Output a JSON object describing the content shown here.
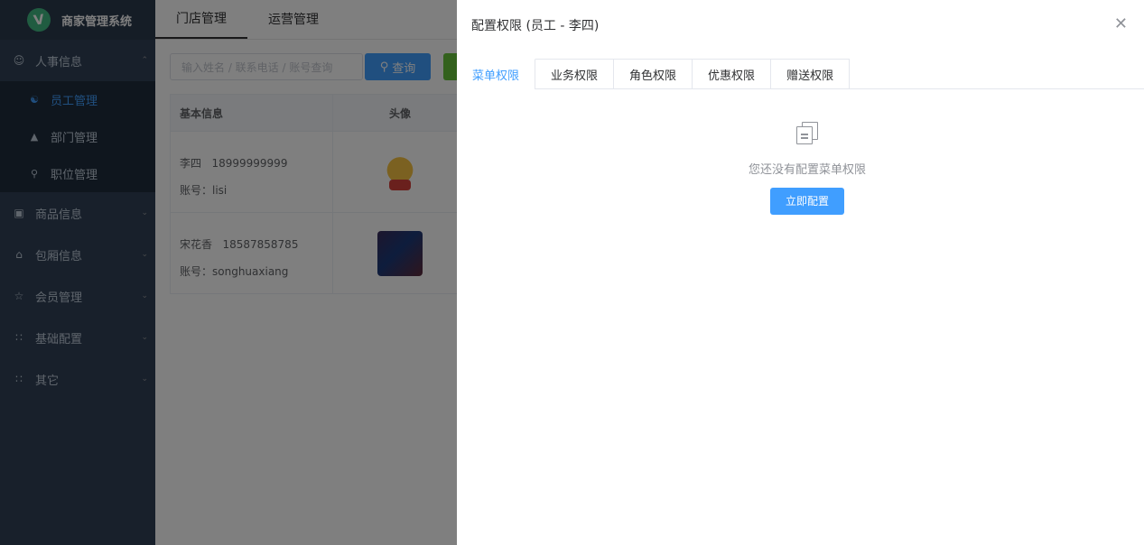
{
  "sidebar": {
    "logo_letter": "V",
    "title": "商家管理系统",
    "menu": [
      {
        "label": "人事信息",
        "icon": "user-icon"
      },
      {
        "label": "商品信息",
        "icon": "goods-icon"
      },
      {
        "label": "包厢信息",
        "icon": "room-icon"
      },
      {
        "label": "会员管理",
        "icon": "member-icon"
      },
      {
        "label": "基础配置",
        "icon": "grid-icon"
      },
      {
        "label": "其它",
        "icon": "grid-icon"
      }
    ],
    "submenu": [
      {
        "label": "员工管理",
        "icon": "staff-icon",
        "active": true
      },
      {
        "label": "部门管理",
        "icon": "org-icon"
      },
      {
        "label": "职位管理",
        "icon": "position-icon"
      }
    ]
  },
  "main": {
    "tabs": [
      "门店管理",
      "运营管理"
    ],
    "search": {
      "placeholder": "输入姓名 / 联系电话 / 账号查询",
      "button": "查询"
    },
    "table": {
      "headers": [
        "基本信息",
        "头像"
      ],
      "rows": [
        {
          "name": "李四",
          "phone": "18999999999",
          "account": "账号：lisi"
        },
        {
          "name": "宋花香",
          "phone": "18587858785",
          "account": "账号：songhuaxiang"
        }
      ]
    }
  },
  "drawer": {
    "title": "配置权限 (员工 - 李四)",
    "tabs": [
      "菜单权限",
      "业务权限",
      "角色权限",
      "优惠权限",
      "赠送权限"
    ],
    "empty_text": "您还没有配置菜单权限",
    "configure_button": "立即配置"
  },
  "colors": {
    "primary": "#409eff",
    "sidebar_bg": "#304156",
    "success": "#67c23a"
  }
}
